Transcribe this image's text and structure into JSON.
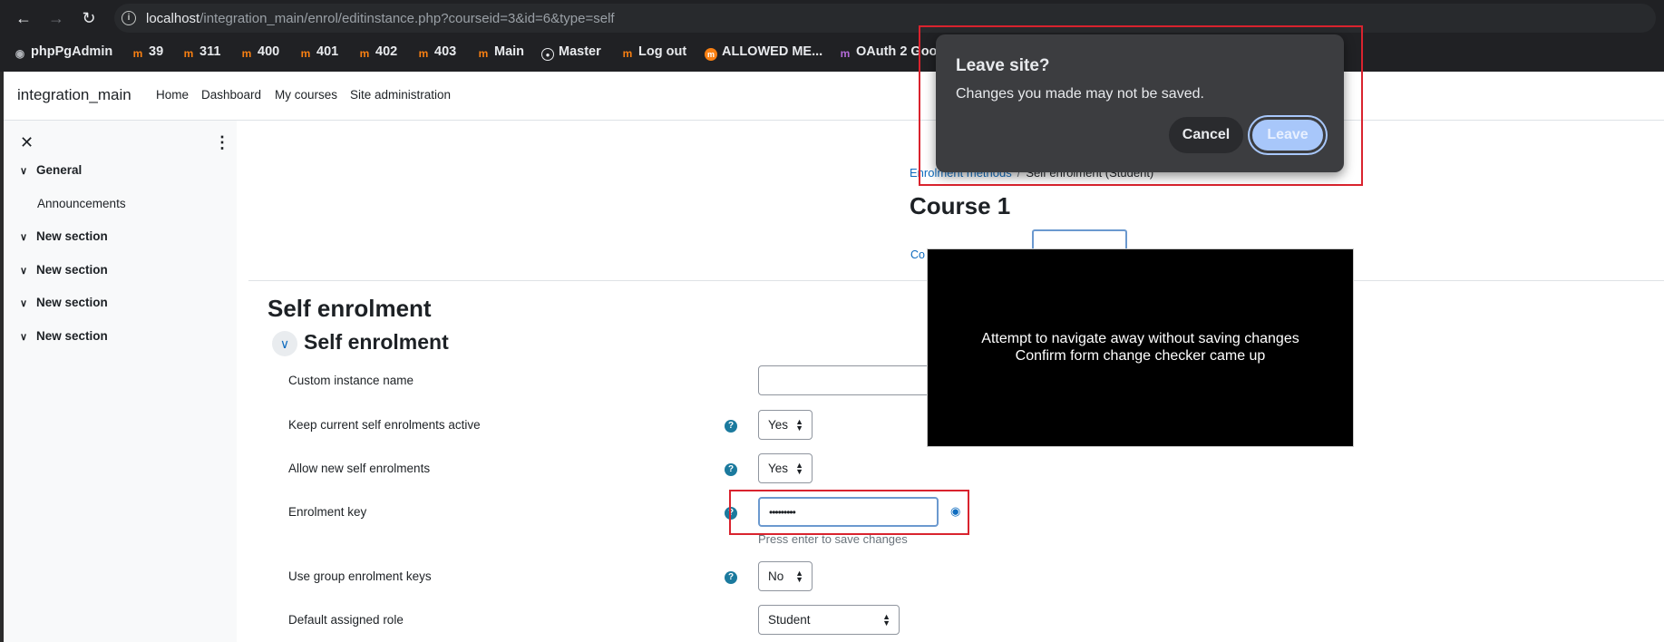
{
  "browser": {
    "url_host": "localhost",
    "url_path": "/integration_main/enrol/editinstance.php?courseid=3&id=6&type=self",
    "bookmarks": [
      {
        "label": "phpPgAdmin",
        "icon": "elephant-icon"
      },
      {
        "label": "39",
        "icon": "moodle-icon"
      },
      {
        "label": "311",
        "icon": "moodle-icon"
      },
      {
        "label": "400",
        "icon": "moodle-icon"
      },
      {
        "label": "401",
        "icon": "moodle-icon"
      },
      {
        "label": "402",
        "icon": "moodle-icon"
      },
      {
        "label": "403",
        "icon": "moodle-icon"
      },
      {
        "label": "Main",
        "icon": "moodle-icon"
      },
      {
        "label": "Master",
        "icon": "globe-icon"
      },
      {
        "label": "Log out",
        "icon": "moodle-icon"
      },
      {
        "label": "ALLOWED ME...",
        "icon": "moodle-round-icon"
      },
      {
        "label": "OAuth 2 Goo",
        "icon": "oauth-icon"
      }
    ]
  },
  "site": {
    "name": "integration_main",
    "nav": [
      "Home",
      "Dashboard",
      "My courses",
      "Site administration"
    ]
  },
  "drawer": {
    "sections": [
      {
        "label": "General",
        "items": [
          "Announcements"
        ]
      },
      {
        "label": "New section"
      },
      {
        "label": "New section"
      },
      {
        "label": "New section"
      },
      {
        "label": "New section"
      }
    ]
  },
  "breadcrumb": {
    "parent": "Enrolment methods",
    "separator": "/",
    "current": "Self enrolment (Student)"
  },
  "course_title": "Course 1",
  "tab_partial": "Co",
  "page_heading": "Self enrolment",
  "section_heading": "Self enrolment",
  "form": {
    "custom_instance_name": {
      "label": "Custom instance name",
      "value": ""
    },
    "keep_active": {
      "label": "Keep current self enrolments active",
      "value": "Yes"
    },
    "allow_new": {
      "label": "Allow new self enrolments",
      "value": "Yes"
    },
    "enrolment_key": {
      "label": "Enrolment key",
      "value": "•••••••••",
      "hint": "Press enter to save changes"
    },
    "group_keys": {
      "label": "Use group enrolment keys",
      "value": "No"
    },
    "default_role": {
      "label": "Default assigned role",
      "value": "Student"
    }
  },
  "annotation": {
    "line1": "Attempt to navigate away without saving changes",
    "line2": "Confirm form change checker came up"
  },
  "dialog": {
    "title": "Leave site?",
    "message": "Changes you made may not be saved.",
    "cancel": "Cancel",
    "leave": "Leave"
  },
  "colors": {
    "accent": "#0f6cbf",
    "moodle_orange": "#f98012",
    "annotation_red": "#d9232e",
    "dialog_bg": "#3c3d40",
    "leave_button": "#a8c7fa"
  }
}
